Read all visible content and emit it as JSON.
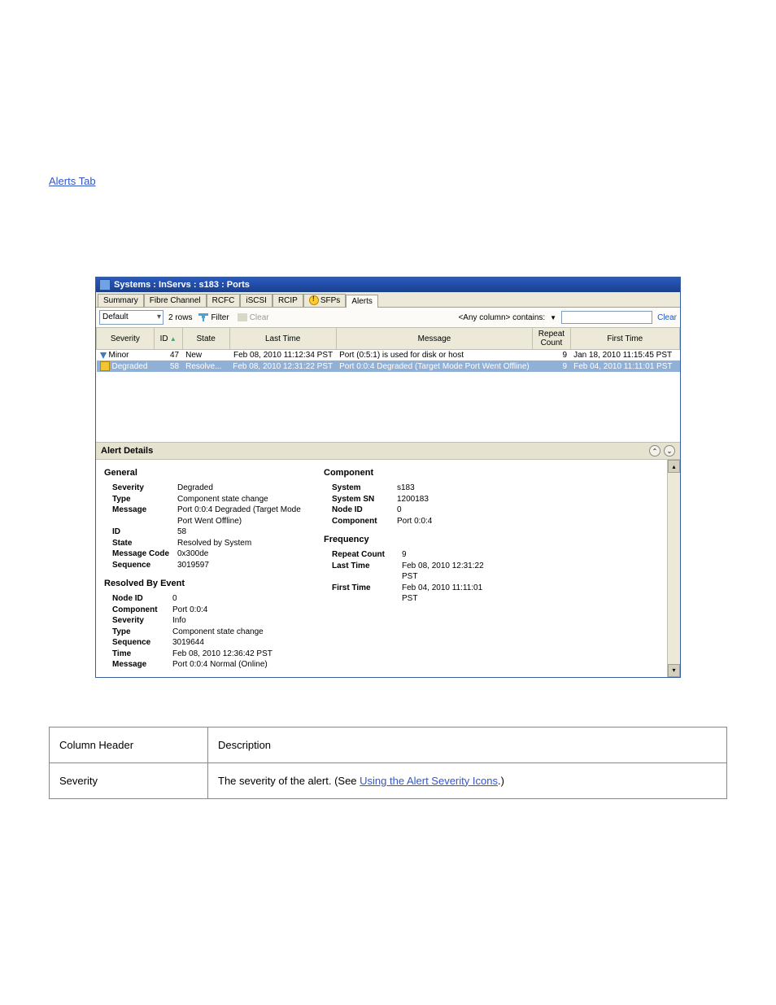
{
  "intro_link_text": "Alerts Tab",
  "window": {
    "title": "Systems : InServs : s183 : Ports",
    "tabs": [
      "Summary",
      "Fibre Channel",
      "RCFC",
      "iSCSI",
      "RCIP",
      "SFPs",
      "Alerts"
    ],
    "active_tab_index": 6,
    "sfp_has_warning": true,
    "toolbar": {
      "dropdown_value": "Default",
      "rows_label": "2 rows",
      "filter_label": "Filter",
      "clear_label": "Clear",
      "anycol_label": "<Any column> contains:",
      "clear_link": "Clear"
    },
    "columns": [
      "Severity",
      "ID",
      "State",
      "Last Time",
      "Message",
      "Repeat Count",
      "First Time"
    ],
    "rows": [
      {
        "severity": "Minor",
        "severity_kind": "minor",
        "id": "47",
        "state": "New",
        "last_time": "Feb 08, 2010 11:12:34 PST",
        "message": "Port (0:5:1) is used for disk or host",
        "repeat": "9",
        "first_time": "Jan 18, 2010 11:15:45 PST",
        "selected": false
      },
      {
        "severity": "Degraded",
        "severity_kind": "degraded",
        "id": "58",
        "state": "Resolve...",
        "last_time": "Feb 08, 2010 12:31:22 PST",
        "message": "Port 0:0:4 Degraded (Target Mode Port Went Offline)",
        "repeat": "9",
        "first_time": "Feb 04, 2010 11:11:01 PST",
        "selected": true
      }
    ],
    "details": {
      "header": "Alert Details",
      "general_title": "General",
      "general": {
        "Severity": "Degraded",
        "Type": "Component state change",
        "Message": "Port 0:0:4 Degraded (Target Mode Port Went Offline)",
        "ID": "58",
        "State": "Resolved by System",
        "Message Code": "0x300de",
        "Sequence": "3019597"
      },
      "component_title": "Component",
      "component": {
        "System": "s183",
        "System SN": "1200183",
        "Node ID": "0",
        "Component": "Port 0:0:4"
      },
      "frequency_title": "Frequency",
      "frequency": {
        "Repeat Count": "9",
        "Last Time": "Feb 08, 2010 12:31:22 PST",
        "First Time": "Feb 04, 2010 11:11:01 PST"
      },
      "resolved_title": "Resolved By Event",
      "resolved": {
        "Node ID": "0",
        "Component": "Port 0:0:4",
        "Severity": "Info",
        "Type": "Component state change",
        "Sequence": "3019644",
        "Time": "Feb 08, 2010 12:36:42 PST",
        "Message": "Port 0:0:4 Normal (Online)"
      }
    }
  },
  "col_table": {
    "header_row": [
      "Column Header",
      "Description"
    ],
    "rows": [
      {
        "h": "Severity",
        "d_before": "The severity of the alert. (See ",
        "d_link": "Using the Alert Severity Icons",
        "d_after": ".)"
      }
    ]
  }
}
